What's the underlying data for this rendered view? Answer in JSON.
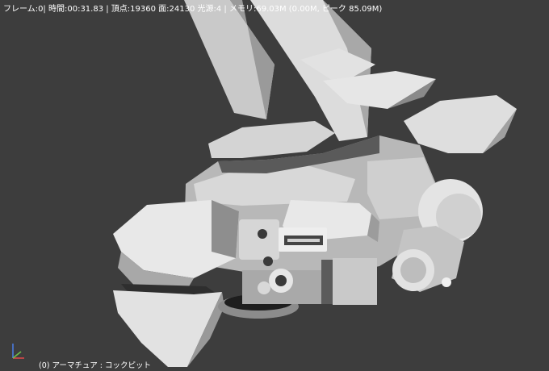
{
  "viewport": {
    "stats_text": "フレーム:0| 時間:00:31.83 | 頂点:19360 面:24130 光源:4 | メモリ:69.03M (0.00M, ピーク 85.09M)",
    "object_label": "(0) アーマチュア : コックピット",
    "background_color": "#3d3d3d",
    "text_color": "#ffffff"
  },
  "axis_gizmo": {
    "x_color": "#d94848",
    "y_color": "#6fc04a",
    "z_color": "#4a7be0"
  }
}
